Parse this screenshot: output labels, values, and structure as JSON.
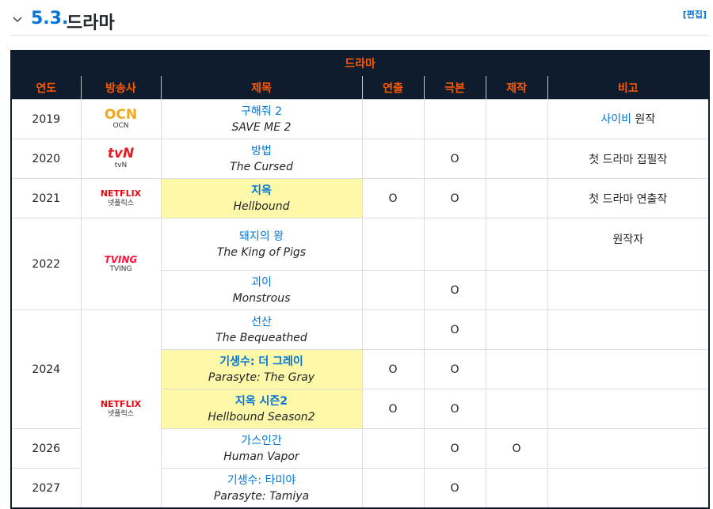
{
  "section": {
    "number": "5.3.",
    "title": "드라마",
    "edit_label": "[편집]"
  },
  "table": {
    "caption": "드라마",
    "headers": [
      "연도",
      "방송사",
      "제목",
      "연출",
      "극본",
      "제작",
      "비고"
    ],
    "years": [
      "2019",
      "2020",
      "2021",
      "2022",
      "2024",
      "2026",
      "2027"
    ],
    "networks": {
      "ocn": {
        "logo": "OCN",
        "label": "OCN"
      },
      "tvn": {
        "logo": "tvN",
        "label": "tvN"
      },
      "netflix1": {
        "logo": "NETFLIX",
        "label": "넷플릭스"
      },
      "tving": {
        "logo": "TVING",
        "label": "TVING"
      },
      "netflix2": {
        "logo": "NETFLIX",
        "label": "넷플릭스"
      }
    },
    "colors": {
      "header_bg": "#0f1c2e",
      "header_text": "#ff5900",
      "link": "#0275d8",
      "highlight": "#fdf9a9"
    },
    "rows": [
      {
        "title": "구해줘 2",
        "subtitle": "SAVE ME 2",
        "directing": "",
        "writing": "",
        "production": "",
        "note_link": "사이비",
        "note": " 원작"
      },
      {
        "title": "방법",
        "subtitle": "The Cursed",
        "directing": "",
        "writing": "O",
        "production": "",
        "note_link": "",
        "note": "첫 드라마 집필작"
      },
      {
        "title": "지옥",
        "subtitle": "Hellbound",
        "directing": "O",
        "writing": "O",
        "production": "",
        "note_link": "",
        "note": "첫 드라마 연출작"
      },
      {
        "title": "돼지의 왕",
        "subtitle": "The King of Pigs",
        "directing": "",
        "writing": "",
        "production": "",
        "note_link": "",
        "note": "원작자"
      },
      {
        "title": "괴이",
        "subtitle": "Monstrous",
        "directing": "",
        "writing": "O",
        "production": "",
        "note_link": "",
        "note": ""
      },
      {
        "title": "선산",
        "subtitle": "The Bequeathed",
        "directing": "",
        "writing": "O",
        "production": "",
        "note_link": "",
        "note": ""
      },
      {
        "title": "기생수: 더 그레이",
        "subtitle": "Parasyte: The Gray",
        "directing": "O",
        "writing": "O",
        "production": "",
        "note_link": "",
        "note": ""
      },
      {
        "title": "지옥 시즌2",
        "subtitle": "Hellbound Season2",
        "directing": "O",
        "writing": "O",
        "production": "",
        "note_link": "",
        "note": ""
      },
      {
        "title": "가스인간",
        "subtitle": "Human Vapor",
        "directing": "",
        "writing": "O",
        "production": "O",
        "note_link": "",
        "note": ""
      },
      {
        "title": "기생수: 타미야",
        "subtitle": "Parasyte: Tamiya",
        "directing": "",
        "writing": "O",
        "production": "",
        "note_link": "",
        "note": ""
      }
    ]
  }
}
